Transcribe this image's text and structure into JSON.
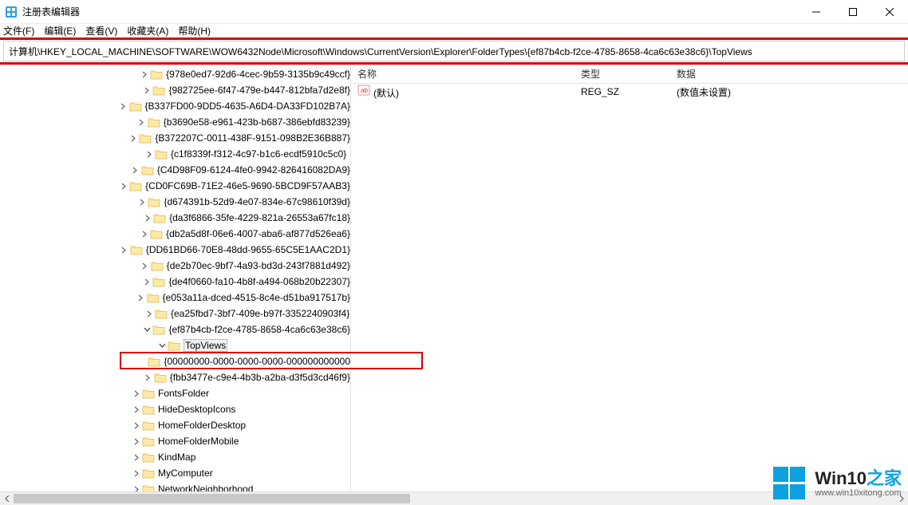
{
  "window": {
    "title": "注册表编辑器"
  },
  "menu": {
    "file": "文件(F)",
    "edit": "编辑(E)",
    "view": "查看(V)",
    "favorites": "收藏夹(A)",
    "help": "帮助(H)"
  },
  "address": "计算机\\HKEY_LOCAL_MACHINE\\SOFTWARE\\WOW6432Node\\Microsoft\\Windows\\CurrentVersion\\Explorer\\FolderTypes\\{ef87b4cb-f2ce-4785-8658-4ca6c63e38c6}\\TopViews",
  "tree": [
    {
      "depth": 5,
      "exp": "closed",
      "label": "{978e0ed7-92d6-4cec-9b59-3135b9c49ccf}"
    },
    {
      "depth": 5,
      "exp": "closed",
      "label": "{982725ee-6f47-479e-b447-812bfa7d2e8f}"
    },
    {
      "depth": 5,
      "exp": "closed",
      "label": "{B337FD00-9DD5-4635-A6D4-DA33FD102B7A}"
    },
    {
      "depth": 5,
      "exp": "closed",
      "label": "{b3690e58-e961-423b-b687-386ebfd83239}"
    },
    {
      "depth": 5,
      "exp": "closed",
      "label": "{B372207C-0011-438F-9151-098B2E36B887}"
    },
    {
      "depth": 5,
      "exp": "closed",
      "label": "{c1f8339f-f312-4c97-b1c6-ecdf5910c5c0}"
    },
    {
      "depth": 5,
      "exp": "closed",
      "label": "{C4D98F09-6124-4fe0-9942-826416082DA9}"
    },
    {
      "depth": 5,
      "exp": "closed",
      "label": "{CD0FC69B-71E2-46e5-9690-5BCD9F57AAB3}"
    },
    {
      "depth": 5,
      "exp": "closed",
      "label": "{d674391b-52d9-4e07-834e-67c98610f39d}"
    },
    {
      "depth": 5,
      "exp": "closed",
      "label": "{da3f6866-35fe-4229-821a-26553a67fc18}"
    },
    {
      "depth": 5,
      "exp": "closed",
      "label": "{db2a5d8f-06e6-4007-aba6-af877d526ea6}"
    },
    {
      "depth": 5,
      "exp": "closed",
      "label": "{DD61BD66-70E8-48dd-9655-65C5E1AAC2D1}"
    },
    {
      "depth": 5,
      "exp": "closed",
      "label": "{de2b70ec-9bf7-4a93-bd3d-243f7881d492}"
    },
    {
      "depth": 5,
      "exp": "closed",
      "label": "{de4f0660-fa10-4b8f-a494-068b20b22307}"
    },
    {
      "depth": 5,
      "exp": "closed",
      "label": "{e053a11a-dced-4515-8c4e-d51ba917517b}"
    },
    {
      "depth": 5,
      "exp": "closed",
      "label": "{ea25fbd7-3bf7-409e-b97f-3352240903f4}"
    },
    {
      "depth": 5,
      "exp": "open",
      "label": "{ef87b4cb-f2ce-4785-8658-4ca6c63e38c6}"
    },
    {
      "depth": 6,
      "exp": "open",
      "label": "TopViews",
      "selected": true
    },
    {
      "depth": 7,
      "exp": "none",
      "label": "{00000000-0000-0000-0000-000000000000"
    },
    {
      "depth": 5,
      "exp": "closed",
      "label": "{fbb3477e-c9e4-4b3b-a2ba-d3f5d3cd46f9}"
    },
    {
      "depth": 4,
      "exp": "closed",
      "label": "FontsFolder"
    },
    {
      "depth": 4,
      "exp": "closed",
      "label": "HideDesktopIcons"
    },
    {
      "depth": 4,
      "exp": "closed",
      "label": "HomeFolderDesktop"
    },
    {
      "depth": 4,
      "exp": "closed",
      "label": "HomeFolderMobile"
    },
    {
      "depth": 4,
      "exp": "closed",
      "label": "KindMap"
    },
    {
      "depth": 4,
      "exp": "closed",
      "label": "MyComputer"
    },
    {
      "depth": 4,
      "exp": "closed",
      "label": "NetworkNeighborhood"
    }
  ],
  "columns": {
    "name": "名称",
    "type": "类型",
    "data": "数据"
  },
  "values": [
    {
      "name": "(默认)",
      "type": "REG_SZ",
      "data": "(数值未设置)"
    }
  ],
  "watermark": {
    "brand_a": "Win10",
    "brand_b": "之家",
    "url": "www.win10xitong.com"
  }
}
